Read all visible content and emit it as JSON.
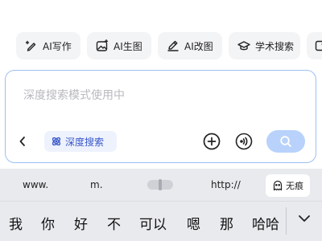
{
  "tools": [
    {
      "label": "AI写作",
      "icon": "pen-sparkle-icon"
    },
    {
      "label": "AI生图",
      "icon": "image-sparkle-icon"
    },
    {
      "label": "AI改图",
      "icon": "edit-image-icon"
    },
    {
      "label": "学术搜索",
      "icon": "graduation-cap-icon"
    },
    {
      "label": "",
      "icon": "image-icon"
    }
  ],
  "input": {
    "placeholder": "深度搜索模式使用中",
    "mode_chip": "深度搜索"
  },
  "colors": {
    "accent": "#3856c9",
    "send_button": "#b8d2fb",
    "input_border": "#9cc0f4"
  },
  "keyboard": {
    "suggestions": {
      "www": "www.",
      "m": "m.",
      "http": "http://",
      "incognito": "无痕"
    },
    "candidates": [
      "我",
      "你",
      "好",
      "不",
      "可以",
      "嗯",
      "那",
      "哈哈"
    ]
  }
}
